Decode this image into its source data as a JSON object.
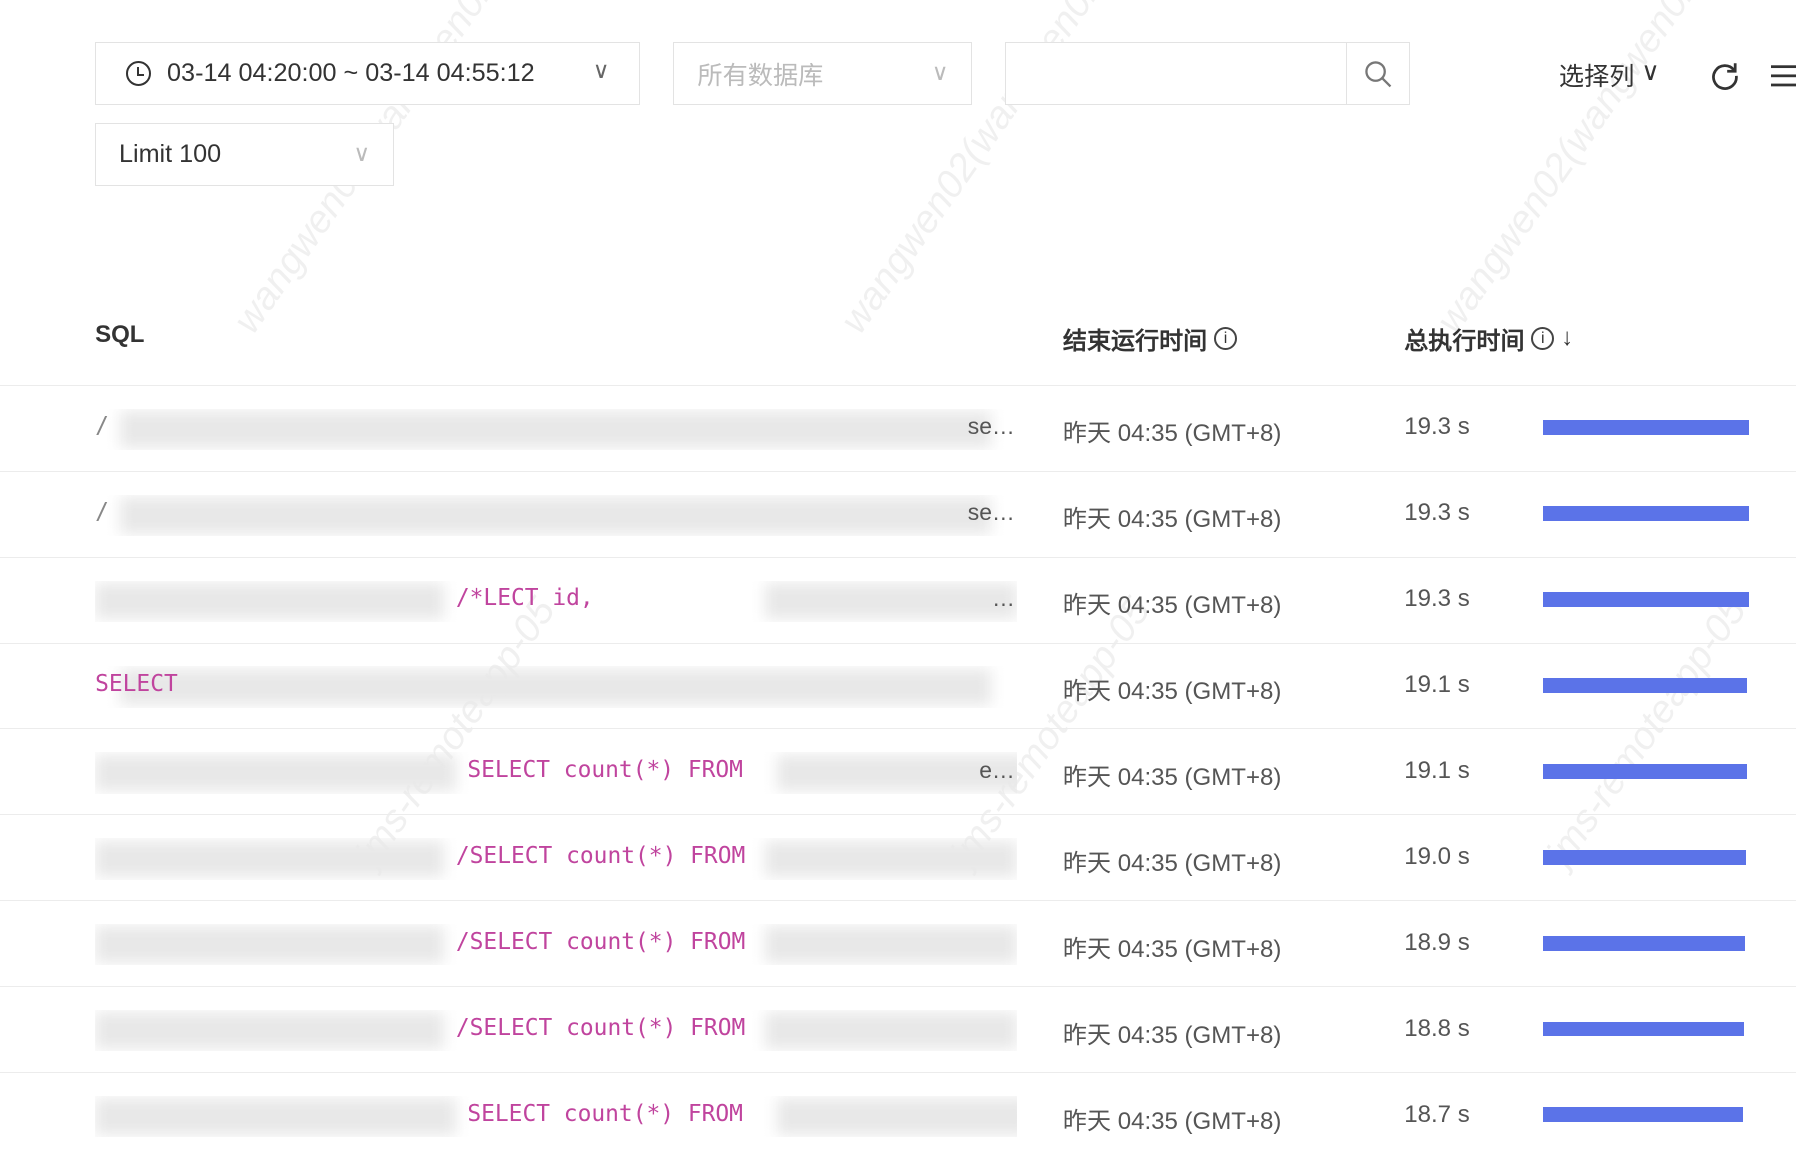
{
  "toolbar": {
    "time_range": "03-14 04:20:00 ~ 03-14 04:55:12",
    "database_placeholder": "所有数据库",
    "search_value": "",
    "select_columns": "选择列",
    "limit": "Limit 100"
  },
  "watermark": [
    "wangwen02(wangwen02)",
    "jms-remoteapp-05"
  ],
  "table": {
    "columns": {
      "sql": "SQL",
      "end_time": "结束运行时间",
      "total_time": "总执行时间"
    },
    "rows": [
      {
        "sql_prefix": "/",
        "sql_frag": "",
        "sql_suffix": "se…",
        "end": "昨天 04:35 (GMT+8)",
        "duration": "19.3 s",
        "value": 19.3
      },
      {
        "sql_prefix": "/",
        "sql_frag": "",
        "sql_suffix": "se…",
        "end": "昨天 04:35 (GMT+8)",
        "duration": "19.3 s",
        "value": 19.3
      },
      {
        "sql_prefix": "",
        "sql_frag": "/*LECT id,",
        "sql_suffix": "…",
        "end": "昨天 04:35 (GMT+8)",
        "duration": "19.3 s",
        "value": 19.3
      },
      {
        "sql_prefix": "SELECT",
        "sql_frag": "",
        "sql_suffix": "",
        "end": "昨天 04:35 (GMT+8)",
        "duration": "19.1 s",
        "value": 19.1
      },
      {
        "sql_prefix": "",
        "sql_frag": "SELECT count(*) FROM",
        "sql_suffix": "e…",
        "end": "昨天 04:35 (GMT+8)",
        "duration": "19.1 s",
        "value": 19.1
      },
      {
        "sql_prefix": "",
        "sql_frag": "/SELECT count(*) FROM",
        "sql_suffix": "",
        "end": "昨天 04:35 (GMT+8)",
        "duration": "19.0 s",
        "value": 19.0
      },
      {
        "sql_prefix": "",
        "sql_frag": "/SELECT count(*) FROM",
        "sql_suffix": "",
        "end": "昨天 04:35 (GMT+8)",
        "duration": "18.9 s",
        "value": 18.9
      },
      {
        "sql_prefix": "",
        "sql_frag": "/SELECT count(*) FROM",
        "sql_suffix": "",
        "end": "昨天 04:35 (GMT+8)",
        "duration": "18.8 s",
        "value": 18.8
      },
      {
        "sql_prefix": "",
        "sql_frag": "SELECT count(*) FROM",
        "sql_suffix": "",
        "end": "昨天 04:35 (GMT+8)",
        "duration": "18.7 s",
        "value": 18.7
      }
    ],
    "bar_color": "#5b73e8"
  }
}
